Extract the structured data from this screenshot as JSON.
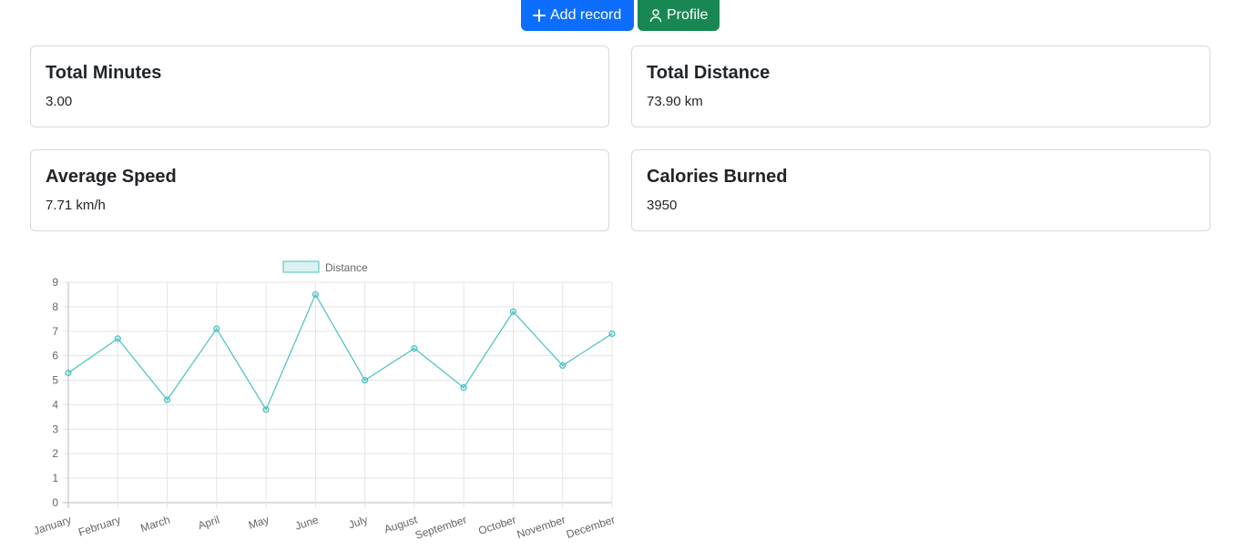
{
  "toolbar": {
    "add_label": "Add record",
    "profile_label": "Profile"
  },
  "cards": {
    "minutes": {
      "title": "Total Minutes",
      "value": "3.00"
    },
    "distance": {
      "title": "Total Distance",
      "value": "73.90 km"
    },
    "speed": {
      "title": "Average Speed",
      "value": "7.71 km/h"
    },
    "calories": {
      "title": "Calories Burned",
      "value": "3950"
    }
  },
  "colors": {
    "primary": "#0d6efd",
    "success": "#198754",
    "series_line": "#4bc0c0",
    "series_fill": "rgba(75,192,192,0.2)"
  },
  "chart_data": {
    "type": "line",
    "categories": [
      "January",
      "February",
      "March",
      "April",
      "May",
      "June",
      "July",
      "August",
      "September",
      "October",
      "November",
      "December"
    ],
    "series": [
      {
        "name": "Distance",
        "values": [
          5.3,
          6.7,
          4.2,
          7.1,
          3.8,
          8.5,
          5.0,
          6.3,
          4.7,
          7.8,
          5.6,
          6.9
        ]
      }
    ],
    "ylim": [
      0,
      9
    ],
    "yticks": [
      "0",
      "1",
      "2",
      "3",
      "4",
      "5",
      "6",
      "7",
      "8",
      "9"
    ],
    "grid": true,
    "legend": "top-center"
  }
}
